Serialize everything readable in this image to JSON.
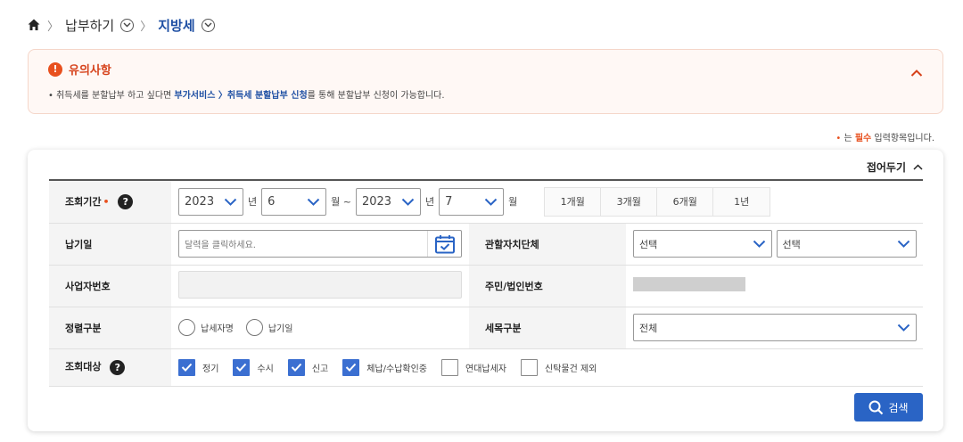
{
  "breadcrumb": {
    "home_icon": "home-icon",
    "items": [
      {
        "label": "납부하기"
      },
      {
        "label": "지방세"
      }
    ]
  },
  "notice": {
    "title": "유의사항",
    "text_pre": "• 취득세를 분할납부 하고 싶다면 ",
    "link1": "부가서비스 〉취득세 분할납부 신청",
    "text_post": "를 통해 분할납부 신청이 가능합니다."
  },
  "required_note": {
    "dot": "•",
    "pre": " 는 ",
    "req": "필수",
    "post": " 입력항목입니다."
  },
  "panel": {
    "fold_label": "접어두기",
    "period": {
      "label": "조회기간",
      "required_mark": "•",
      "start_year": "2023",
      "start_month": "6",
      "end_year": "2023",
      "end_month": "7",
      "year_unit": "년",
      "month_unit_tilde": "월 ~",
      "month_unit": "월",
      "quick": [
        "1개월",
        "3개월",
        "6개월",
        "1년"
      ]
    },
    "pay_date": {
      "label": "납기일",
      "placeholder": "달력을 클릭하세요."
    },
    "jurisdiction": {
      "label": "관할자치단체",
      "select1": "선택",
      "select2": "선택"
    },
    "biz_no": {
      "label": "사업자번호"
    },
    "resident_no": {
      "label": "주민/법인번호"
    },
    "sort": {
      "label": "정렬구분",
      "options": [
        "납세자명",
        "납기일"
      ]
    },
    "tax_item": {
      "label": "세목구분",
      "value": "전체"
    },
    "target": {
      "label": "조회대상",
      "options": [
        {
          "label": "정기",
          "checked": true
        },
        {
          "label": "수시",
          "checked": true
        },
        {
          "label": "신고",
          "checked": true
        },
        {
          "label": "체납/수납확인중",
          "checked": true
        },
        {
          "label": "연대납세자",
          "checked": false
        },
        {
          "label": "신탁물건 제외",
          "checked": false
        }
      ]
    },
    "search_label": "검색"
  },
  "colors": {
    "accent": "#2a64c5",
    "warning": "#e8501e",
    "link": "#1e4fa3"
  }
}
